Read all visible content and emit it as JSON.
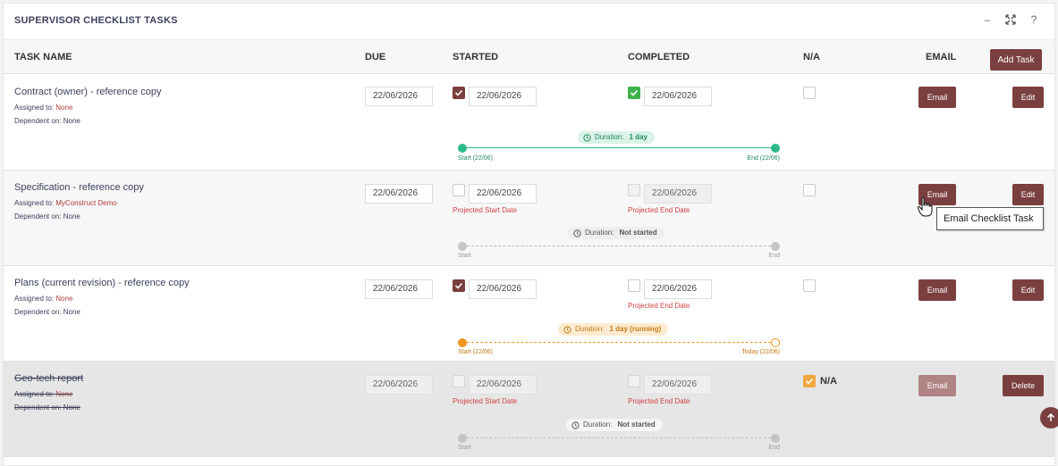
{
  "panel": {
    "title": "SUPERVISOR CHECKLIST TASKS",
    "icons": [
      "minimize-icon",
      "expand-icon",
      "help-icon"
    ],
    "minimize_glyph": "–",
    "help_glyph": "?"
  },
  "columns": {
    "task_name": "TASK NAME",
    "due": "DUE",
    "started": "STARTED",
    "completed": "COMPLETED",
    "na": "N/A",
    "email": "EMAIL",
    "add_task": "Add Task"
  },
  "labels": {
    "assigned_to": "Assigned to:",
    "dependent_on": "Dependent on:",
    "email_button": "Email",
    "edit_button": "Edit",
    "delete_button": "Delete",
    "projected_start": "Projected Start Date",
    "projected_end": "Projected End Date",
    "duration_prefix": "Duration:",
    "na_label": "N/A"
  },
  "tasks": [
    {
      "name": "Contract (owner) - reference copy",
      "assigned_to": "None",
      "dependent_on": "None",
      "due": "22/06/2026",
      "started_checked": true,
      "started_date": "22/06/2026",
      "completed_checked": true,
      "completed_date": "22/06/2026",
      "na_checked": false,
      "duration": "1 day",
      "tl_start": "Start (22/06)",
      "tl_end": "End (22/06)",
      "status": "completed"
    },
    {
      "name": "Specification - reference copy",
      "assigned_to": "MyConstruct Demo",
      "dependent_on": "None",
      "due": "22/06/2026",
      "started_checked": false,
      "started_date": "22/06/2026",
      "completed_checked": false,
      "completed_date": "22/06/2026",
      "na_checked": false,
      "duration": "Not started",
      "tl_start": "Start",
      "tl_end": "End",
      "status": "not_started"
    },
    {
      "name": "Plans (current revision) - reference copy",
      "assigned_to": "None",
      "dependent_on": "None",
      "due": "22/06/2026",
      "started_checked": true,
      "started_date": "22/06/2026",
      "completed_checked": false,
      "completed_date": "22/06/2026",
      "na_checked": false,
      "duration": "1 day (running)",
      "tl_start": "Start (22/06)",
      "tl_end": "Today (22/06)",
      "status": "running"
    },
    {
      "name": "Geo-tech report",
      "assigned_to": "None",
      "dependent_on": "None",
      "due": "22/06/2026",
      "started_checked": false,
      "started_date": "22/06/2026",
      "completed_checked": false,
      "completed_date": "22/06/2026",
      "na_checked": true,
      "duration": "Not started",
      "tl_start": "Start",
      "tl_end": "End",
      "status": "na"
    }
  ],
  "tooltip": "Email Checklist Task",
  "colors": {
    "accent": "#7a3f3f",
    "green": "#2db98a",
    "orange": "#f0951f",
    "warning_text": "#d04040"
  }
}
